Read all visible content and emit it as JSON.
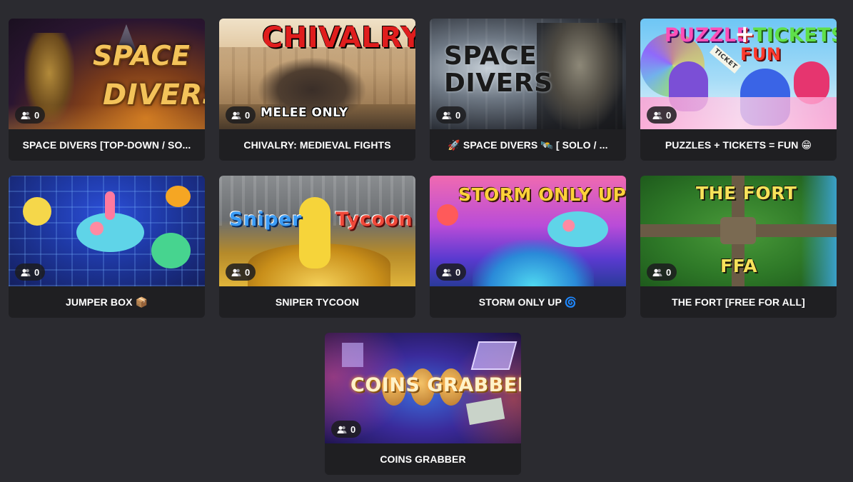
{
  "cards": [
    {
      "caption": "SPACE DIVERS [TOP-DOWN / SO...",
      "players": "0",
      "art": [
        "SPACE",
        "DIVERS"
      ]
    },
    {
      "caption": "CHIVALRY: MEDIEVAL FIGHTS",
      "players": "0",
      "art": [
        "CHIVALRY",
        "MELEE ONLY"
      ]
    },
    {
      "caption": "🚀 SPACE DIVERS 🛰️ [ SOLO / ...",
      "players": "0",
      "art": [
        "SPACE",
        "DIVERS"
      ]
    },
    {
      "caption": "PUZZLES + TICKETS = FUN 😁",
      "players": "0",
      "art": [
        "PUZZLE",
        "+",
        "TICKETS",
        "FUN",
        "TICKET"
      ]
    },
    {
      "caption": "JUMPER BOX 📦",
      "players": "0",
      "art": []
    },
    {
      "caption": "SNIPER TYCOON",
      "players": "0",
      "art": [
        "Sniper",
        "Tycoon"
      ]
    },
    {
      "caption": "STORM ONLY UP 🌀",
      "players": "0",
      "art": [
        "STORM ONLY UP"
      ]
    },
    {
      "caption": "THE FORT [FREE FOR ALL]",
      "players": "0",
      "art": [
        "THE FORT",
        "FFA"
      ]
    },
    {
      "caption": "COINS GRABBER",
      "players": "0",
      "art": [
        "COINS GRABBER"
      ]
    }
  ],
  "icons": {
    "players": "people-icon"
  },
  "colors": {
    "background": "#2b2b30",
    "card": "#1f1f22",
    "badge": "#1c1c1e",
    "text": "#ffffff"
  }
}
